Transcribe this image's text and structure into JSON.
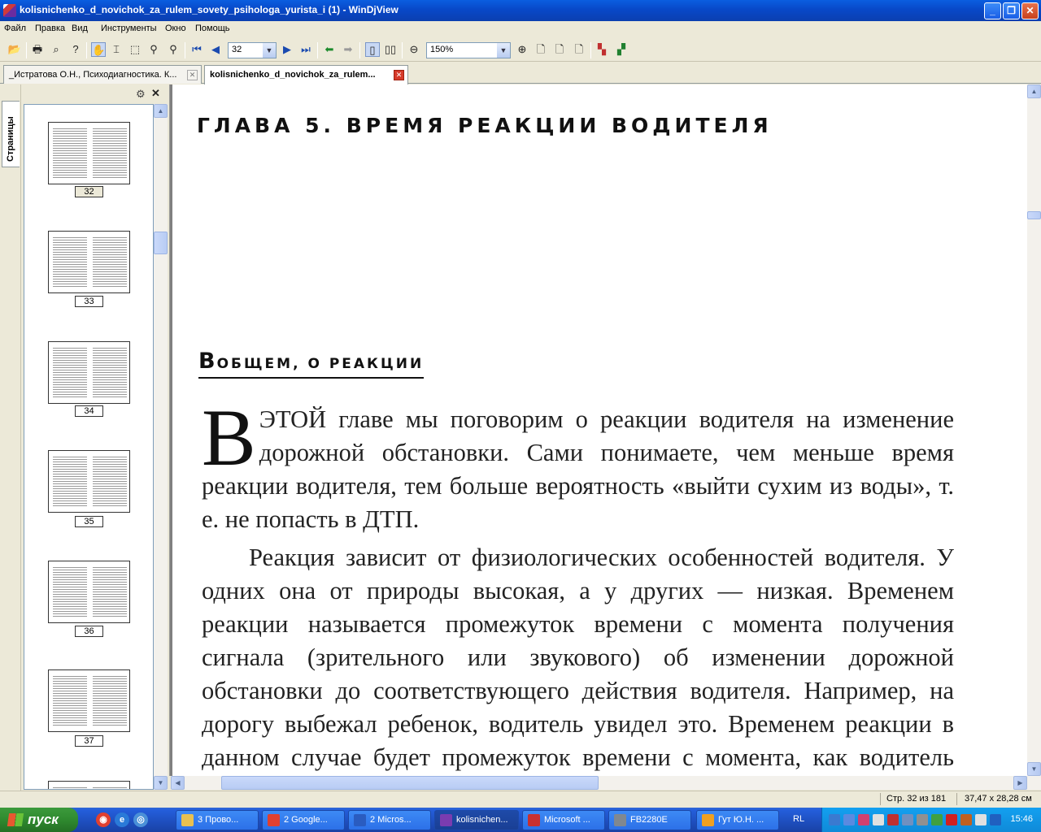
{
  "window": {
    "title": "kolisnichenko_d_novichok_za_rulem_sovety_psihologa_yurista_i (1) - WinDjView",
    "btn_minimize": "_",
    "btn_maximize": "❐",
    "btn_close": "✕"
  },
  "menu": [
    "Файл",
    "Правка",
    "Вид",
    "Инструменты",
    "Окно",
    "Помощь"
  ],
  "toolbar": {
    "page_number": "32",
    "zoom": "150%"
  },
  "tabs": [
    {
      "label": "_Истратова О.Н., Психодиагностика. К..."
    },
    {
      "label": "kolisnichenko_d_novichok_za_rulem..."
    }
  ],
  "sidebar": {
    "tab_label": "Страницы",
    "thumbnails": [
      {
        "page": "32"
      },
      {
        "page": "33"
      },
      {
        "page": "34"
      },
      {
        "page": "35"
      },
      {
        "page": "36"
      },
      {
        "page": "37"
      }
    ]
  },
  "document": {
    "chapter_title": "ГЛАВА 5. ВРЕМЯ РЕАКЦИИ ВОДИТЕЛЯ",
    "section_cap": "В",
    "section_rest": "ОБЩЕМ, О РЕАКЦИИ",
    "drop_cap": "В",
    "para1": "ЭТОЙ главе мы поговорим о реакции водителя на изменение дорожной обстановки. Сами понимаете, чем меньше время реакции водителя, тем больше вероятность «выйти сухим из воды», т. е. не попасть в ДТП.",
    "para2": "Реакция зависит от физиологических особенностей водителя. У одних она от природы высокая, а у других — низкая. Временем реакции называется промежуток времени с момента получения сигнала (зрительного или звукового) об изменении дорожной обстановки до соответствующего действия водителя. Например, на дорогу выбежал ребенок, водитель увидел это. Временем реакции в данном случае будет промежуток времени с момента, как водитель заметил ребенка, до нажатия педали"
  },
  "status": {
    "page_info": "Стр. 32 из 181",
    "page_size": "37,47 x 28,28 см"
  },
  "taskbar": {
    "start": "пуск",
    "tasks": [
      {
        "label": "3 Прово...",
        "color": "#e8c050"
      },
      {
        "label": "2 Google...",
        "color": "#e04030"
      },
      {
        "label": "2 Micros...",
        "color": "#2a5cc0"
      },
      {
        "label": "kolisnichen...",
        "color": "#7a3cb0"
      },
      {
        "label": "Microsoft ...",
        "color": "#c83030"
      },
      {
        "label": "FB2280E",
        "color": "#808890"
      },
      {
        "label": "Гут Ю.Н. ...",
        "color": "#f0a020"
      }
    ],
    "lang": "RL",
    "clock": "15:46"
  }
}
